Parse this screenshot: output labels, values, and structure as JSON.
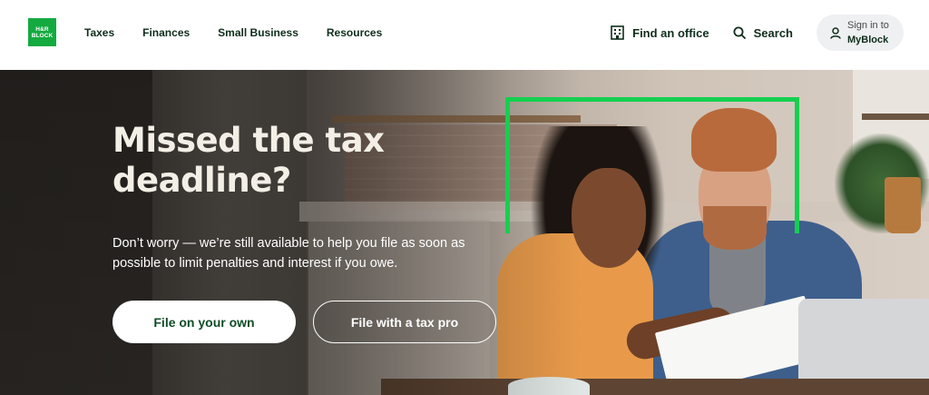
{
  "brand": {
    "logo_line1": "H&R",
    "logo_line2": "BLOCK",
    "color": "#14aa40"
  },
  "nav": {
    "items": [
      {
        "label": "Taxes"
      },
      {
        "label": "Finances"
      },
      {
        "label": "Small Business"
      },
      {
        "label": "Resources"
      }
    ]
  },
  "utility": {
    "find_office": {
      "label": "Find an office",
      "icon": "office-building-icon"
    },
    "search": {
      "label": "Search",
      "icon": "search-icon"
    },
    "signin": {
      "line1": "Sign in to",
      "line2": "MyBlock",
      "icon": "user-icon"
    }
  },
  "hero": {
    "title": "Missed the tax deadline?",
    "subtitle": "Don’t worry — we’re still available to help you file as soon as possible to limit penalties and interest if you owe.",
    "primary_cta": "File on your own",
    "secondary_cta": "File with a tax pro",
    "accent_color": "#14d04f"
  }
}
